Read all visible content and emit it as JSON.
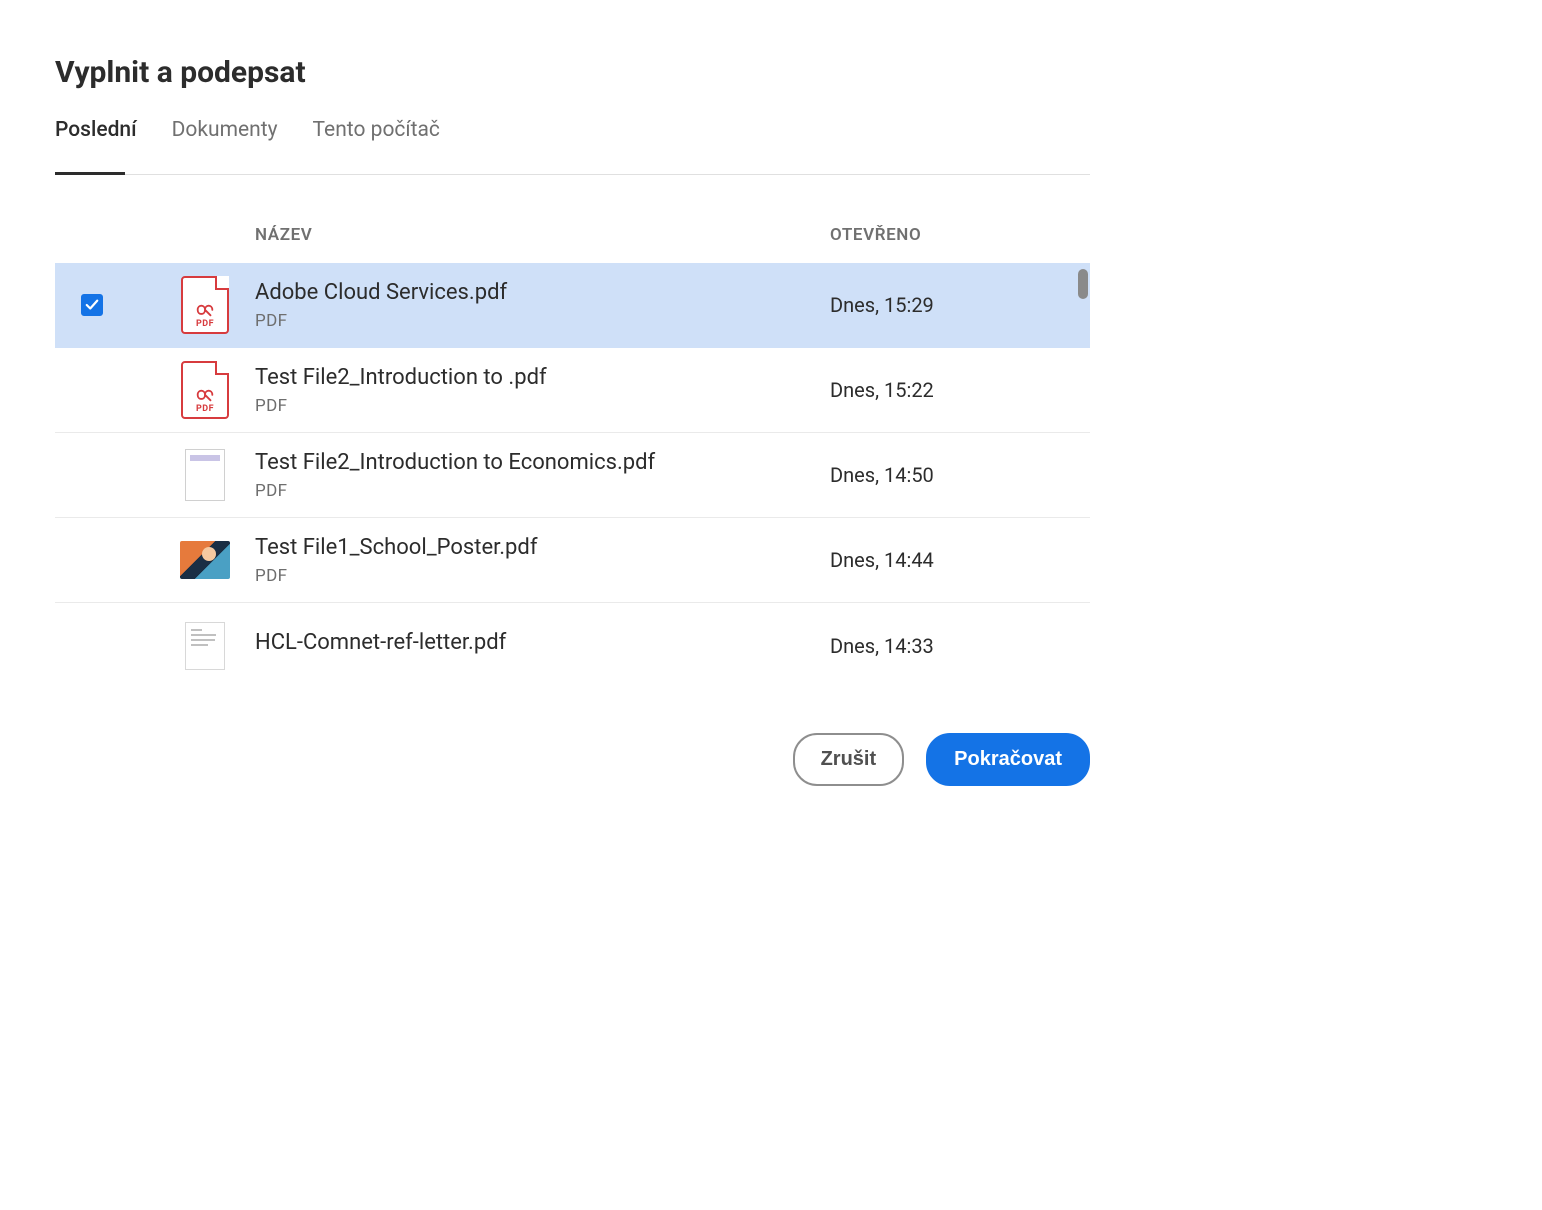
{
  "title": "Vyplnit a podepsat",
  "tabs": [
    {
      "label": "Poslední",
      "active": true
    },
    {
      "label": "Dokumenty",
      "active": false
    },
    {
      "label": "Tento počítač",
      "active": false
    }
  ],
  "columns": {
    "name": "NÁZEV",
    "opened": "OTEVŘENO"
  },
  "files": [
    {
      "name": "Adobe Cloud Services.pdf",
      "type": "PDF",
      "opened": "Dnes, 15:29",
      "selected": true,
      "thumb": "pdf-icon"
    },
    {
      "name": "Test File2_Introduction to  .pdf",
      "type": "PDF",
      "opened": "Dnes, 15:22",
      "selected": false,
      "thumb": "pdf-icon"
    },
    {
      "name": "Test File2_Introduction to Economics.pdf",
      "type": "PDF",
      "opened": "Dnes, 14:50",
      "selected": false,
      "thumb": "doc"
    },
    {
      "name": "Test File1_School_Poster.pdf",
      "type": "PDF",
      "opened": "Dnes, 14:44",
      "selected": false,
      "thumb": "poster"
    },
    {
      "name": "HCL-Comnet-ref-letter.pdf",
      "type": "",
      "opened": "Dnes, 14:33",
      "selected": false,
      "thumb": "letter"
    }
  ],
  "buttons": {
    "cancel": "Zrušit",
    "continue": "Pokračovat"
  },
  "icon_labels": {
    "pdf_badge": "PDF"
  }
}
